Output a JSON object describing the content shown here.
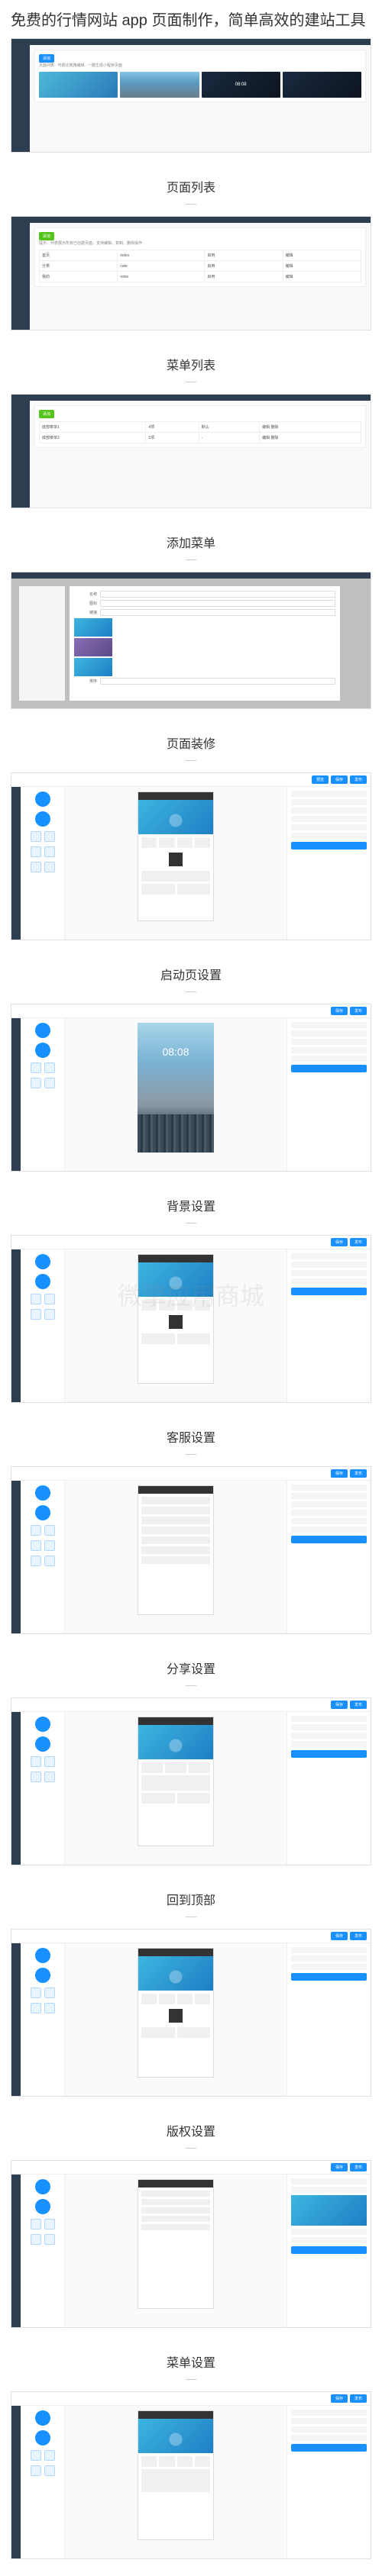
{
  "page_title": "免费的行情网站 app 页面制作，简单高效的建站工具",
  "watermark": "微擎应用商城",
  "sections": [
    {
      "title": "页面列表",
      "sub": ""
    },
    {
      "title": "菜单列表",
      "sub": ""
    },
    {
      "title": "添加菜单",
      "sub": ""
    },
    {
      "title": "页面装修",
      "sub": ""
    },
    {
      "title": "启动页设置",
      "sub": ""
    },
    {
      "title": "背景设置",
      "sub": ""
    },
    {
      "title": "客服设置",
      "sub": ""
    },
    {
      "title": "分享设置",
      "sub": ""
    },
    {
      "title": "回到顶部",
      "sub": ""
    },
    {
      "title": "版权设置",
      "sub": ""
    },
    {
      "title": "菜单设置",
      "sub": ""
    }
  ],
  "splash_time": "08:08",
  "btn_add": "添加",
  "btn_save": "保存",
  "btn_preview": "预览",
  "btn_publish": "发布"
}
